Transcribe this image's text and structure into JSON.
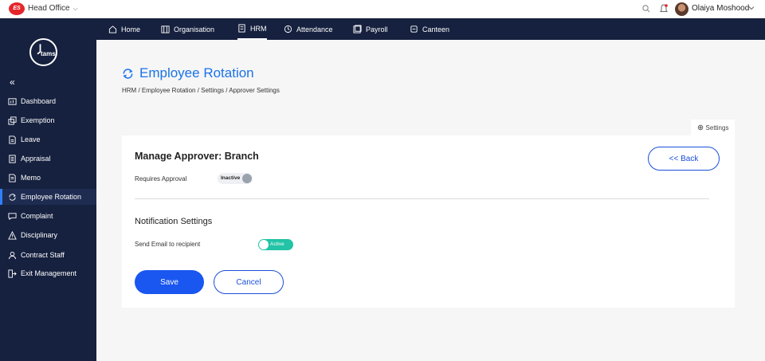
{
  "topbar": {
    "org_name": "Head Office",
    "user_name": "Olaiya Moshood",
    "logo_text": "ES"
  },
  "sidebar": {
    "logo_text": "tams",
    "collapse_glyph": "«",
    "items": [
      {
        "label": "Dashboard",
        "icon": "dashboard-icon"
      },
      {
        "label": "Exemption",
        "icon": "exemption-icon"
      },
      {
        "label": "Leave",
        "icon": "leave-icon"
      },
      {
        "label": "Appraisal",
        "icon": "appraisal-icon"
      },
      {
        "label": "Memo",
        "icon": "memo-icon"
      },
      {
        "label": "Employee Rotation",
        "icon": "rotation-icon",
        "active": true
      },
      {
        "label": "Complaint",
        "icon": "complaint-icon"
      },
      {
        "label": "Disciplinary",
        "icon": "warning-icon"
      },
      {
        "label": "Contract Staff",
        "icon": "user-icon"
      },
      {
        "label": "Exit Management",
        "icon": "exit-icon"
      }
    ]
  },
  "navbar": {
    "tabs": [
      {
        "label": "Home",
        "icon": "home-icon"
      },
      {
        "label": "Organisation",
        "icon": "building-icon"
      },
      {
        "label": "HRM",
        "icon": "hrm-icon",
        "active": true
      },
      {
        "label": "Attendance",
        "icon": "clock-icon"
      },
      {
        "label": "Payroll",
        "icon": "payroll-icon"
      },
      {
        "label": "Canteen",
        "icon": "canteen-icon"
      }
    ]
  },
  "page": {
    "title": "Employee Rotation",
    "breadcrumb": "HRM / Employee Rotation / Settings / Approver Settings",
    "settings_tab": "Settings"
  },
  "card": {
    "title": "Manage Approver: Branch",
    "back_label": "<< Back",
    "requires_approval_label": "Requires Approval",
    "requires_approval_state": "Inactive",
    "notification_title": "Notification Settings",
    "send_email_label": "Send Email to recipient",
    "send_email_state": "Active",
    "save_label": "Save",
    "cancel_label": "Cancel"
  },
  "colors": {
    "sidebar_bg": "#16213f",
    "accent_blue": "#1a56f0",
    "title_blue": "#1a73e8",
    "active_toggle": "#22c3a6",
    "logo_red": "#e4262b"
  }
}
